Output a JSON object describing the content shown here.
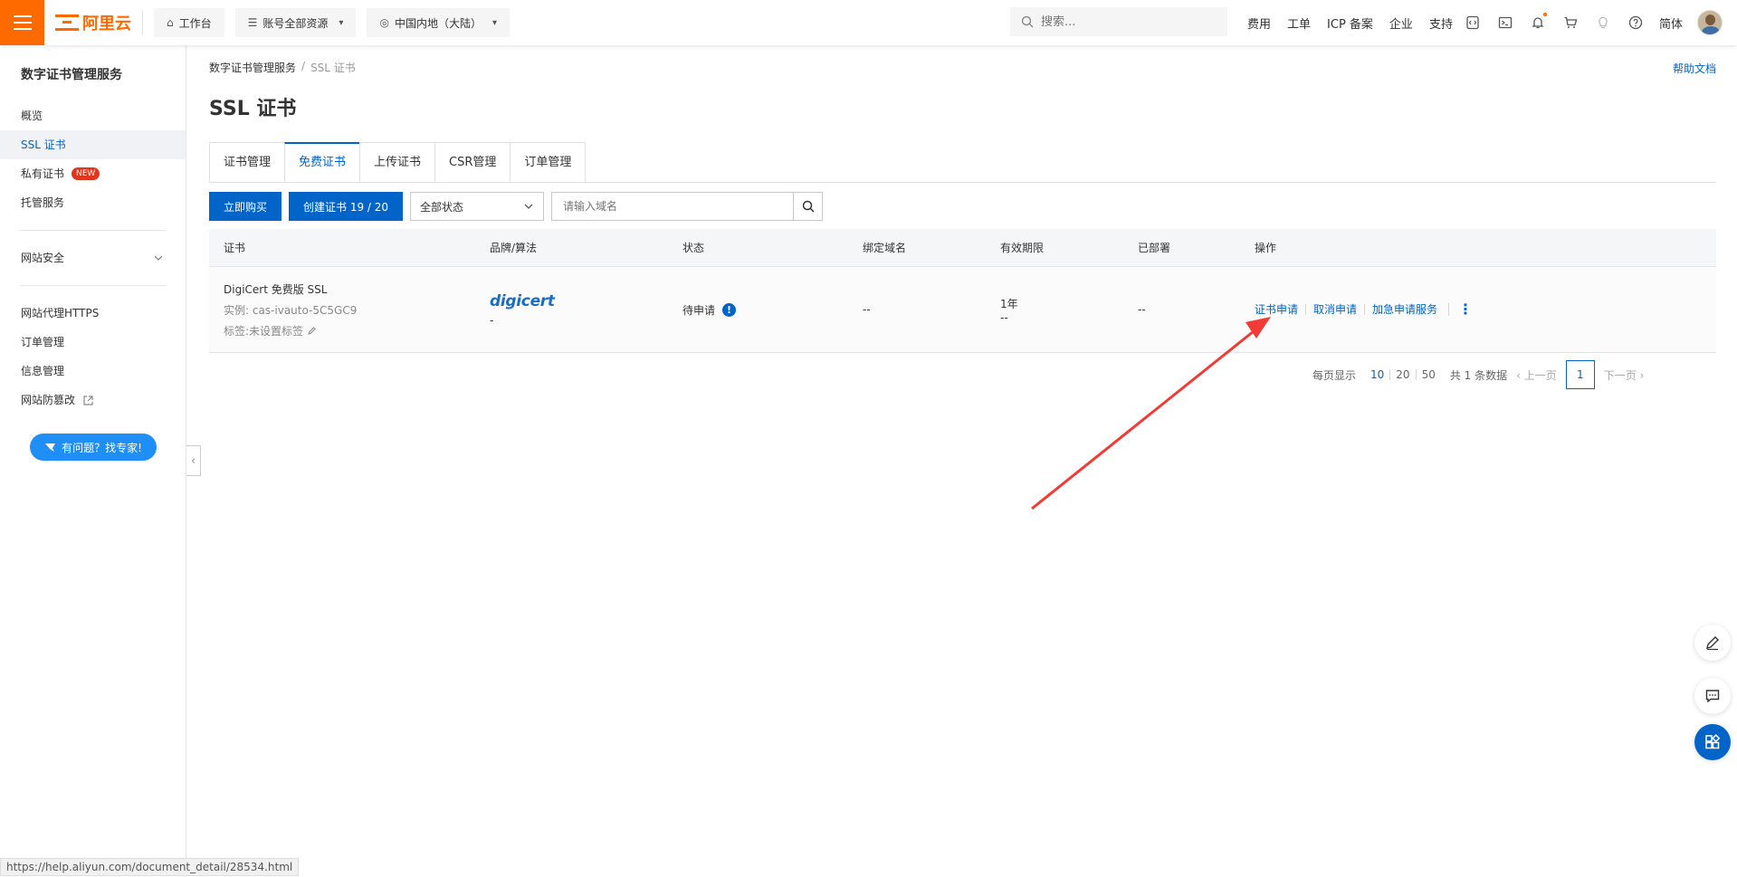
{
  "topbar": {
    "logo_text": "阿里云",
    "workbench": "工作台",
    "account_resources": "账号全部资源",
    "region": "中国内地（大陆）",
    "search_placeholder": "搜索...",
    "links": [
      "费用",
      "工单",
      "ICP 备案",
      "企业",
      "支持"
    ],
    "language": "简体"
  },
  "sidebar": {
    "title": "数字证书管理服务",
    "items": [
      {
        "label": "概览"
      },
      {
        "label": "SSL 证书"
      },
      {
        "label": "私有证书",
        "badge": "NEW"
      },
      {
        "label": "托管服务"
      }
    ],
    "group": "网站安全",
    "items2": [
      {
        "label": "网站代理HTTPS"
      },
      {
        "label": "订单管理"
      },
      {
        "label": "信息管理"
      },
      {
        "label": "网站防篡改"
      }
    ],
    "expert_button": "有问题？找专家!"
  },
  "breadcrumb": {
    "root": "数字证书管理服务",
    "sep": "/",
    "current": "SSL 证书"
  },
  "help_link": "帮助文档",
  "page_title": "SSL 证书",
  "tabs": [
    "证书管理",
    "免费证书",
    "上传证书",
    "CSR管理",
    "订单管理"
  ],
  "toolbar": {
    "buy_now": "立即购买",
    "create_cert": "创建证书 19 / 20",
    "status_select": "全部状态",
    "domain_placeholder": "请输入域名"
  },
  "table": {
    "headers": [
      "证书",
      "品牌/算法",
      "状态",
      "绑定域名",
      "有效期限",
      "已部署",
      "操作"
    ],
    "row": {
      "cert_name": "DigiCert 免费版 SSL",
      "instance": "实例: cas-ivauto-5C5GC9",
      "tag": "标签:未设置标签",
      "brand": "digicert",
      "algorithm": "-",
      "status": "待申请",
      "domain": "--",
      "validity": "1年",
      "validity_sub": "--",
      "deployed": "--",
      "ops": [
        "证书申请",
        "取消申请",
        "加急申请服务"
      ]
    }
  },
  "pager": {
    "per_page_label": "每页显示",
    "sizes": [
      "10",
      "20",
      "50"
    ],
    "total": "共 1 条数据",
    "prev": "上一页",
    "page": "1",
    "next": "下一页"
  },
  "statusbar": "https://help.aliyun.com/document_detail/28534.html",
  "colors": {
    "brand_orange": "#ff6a00",
    "primary_blue": "#0064c8",
    "arrow_red": "#f23b36"
  }
}
